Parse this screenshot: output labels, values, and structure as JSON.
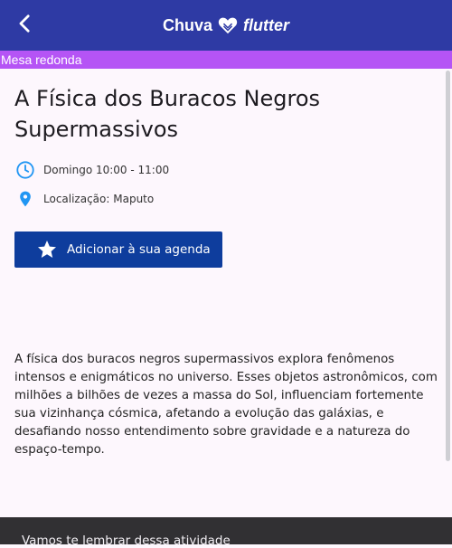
{
  "appbar": {
    "brand_left": "Chuva",
    "brand_right": "flutter",
    "icons": {
      "back": "arrow-back-icon",
      "heart": "heart-icon"
    }
  },
  "category": {
    "label": "Mesa redonda",
    "color": "#b554f5"
  },
  "activity": {
    "title": "A Física dos Buracos Negros Supermassivos",
    "schedule": "Domingo 10:00 - 11:00",
    "location": "Localização: Maputo",
    "add_to_agenda_label": "Adicionar à sua agenda",
    "description": "A física dos buracos negros supermassivos explora fenômenos intensos e enigmáticos no universo. Esses objetos astronômicos, com milhões a bilhões de vezes a massa do Sol, influenciam fortemente sua vizinhança cósmica, afetando a evolução das galáxias, e desafiando nosso entendimento sobre gravidade e a natureza do espaço-tempo."
  },
  "snackbar": {
    "message": "Vamos te lembrar dessa atividade"
  },
  "colors": {
    "appbar": "#2e3aa4",
    "primary_button": "#0e3d9d",
    "icon_accent": "#2196f3",
    "background": "#fdf7fd"
  }
}
